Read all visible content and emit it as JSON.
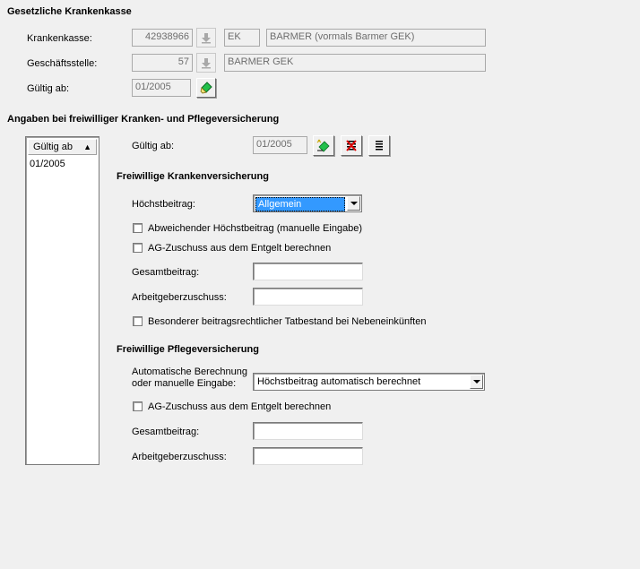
{
  "section1": {
    "title": "Gesetzliche Krankenkasse",
    "krankenkasse_label": "Krankenkasse:",
    "krankenkasse_number": "42938966",
    "krankenkasse_type": "EK",
    "krankenkasse_name": "BARMER (vormals Barmer GEK)",
    "geschaeftsstelle_label": "Geschäftsstelle:",
    "geschaeftsstelle_number": "57",
    "geschaeftsstelle_name": "BARMER GEK",
    "gueltig_label": "Gültig ab:",
    "gueltig_value": "01/2005"
  },
  "section2": {
    "title": "Angaben bei freiwilliger Kranken- und Pflegeversicherung",
    "list_header": "Gültig ab",
    "list_rows": [
      "01/2005"
    ],
    "gueltig_label": "Gültig ab:",
    "gueltig_value": "01/2005"
  },
  "kv": {
    "title": "Freiwillige Krankenversicherung",
    "hoechstbeitrag_label": "Höchstbeitrag:",
    "hoechstbeitrag_value": "Allgemein",
    "abweichend_label": "Abweichender Höchstbeitrag (manuelle Eingabe)",
    "ag_zuschuss_label": "AG-Zuschuss aus dem Entgelt berechnen",
    "gesamtbeitrag_label": "Gesamtbeitrag:",
    "gesamtbeitrag_value": "",
    "arbeitgeberzuschuss_label": "Arbeitgeberzuschuss:",
    "arbeitgeberzuschuss_value": "",
    "besonderer_label": "Besonderer beitragsrechtlicher Tatbestand bei Nebeneinkünften"
  },
  "pv": {
    "title": "Freiwillige Pflegeversicherung",
    "berechnung_label_line1": "Automatische Berechnung",
    "berechnung_label_line2": "oder manuelle Eingabe:",
    "berechnung_value": "Höchstbeitrag automatisch berechnet",
    "ag_zuschuss_label": "AG-Zuschuss aus dem Entgelt berechnen",
    "gesamtbeitrag_label": "Gesamtbeitrag:",
    "gesamtbeitrag_value": "",
    "arbeitgeberzuschuss_label": "Arbeitgeberzuschuss:",
    "arbeitgeberzuschuss_value": ""
  },
  "icons": {
    "download": "download-arrow-icon",
    "edit": "green-diamond-edit-icon",
    "add": "add-entry-icon",
    "delete": "delete-entry-icon",
    "list": "list-icon",
    "dropdown": "chevron-down-icon",
    "sort": "sort-up-icon"
  },
  "colors": {
    "selection": "#3399ff",
    "background": "#f0f0f0"
  }
}
